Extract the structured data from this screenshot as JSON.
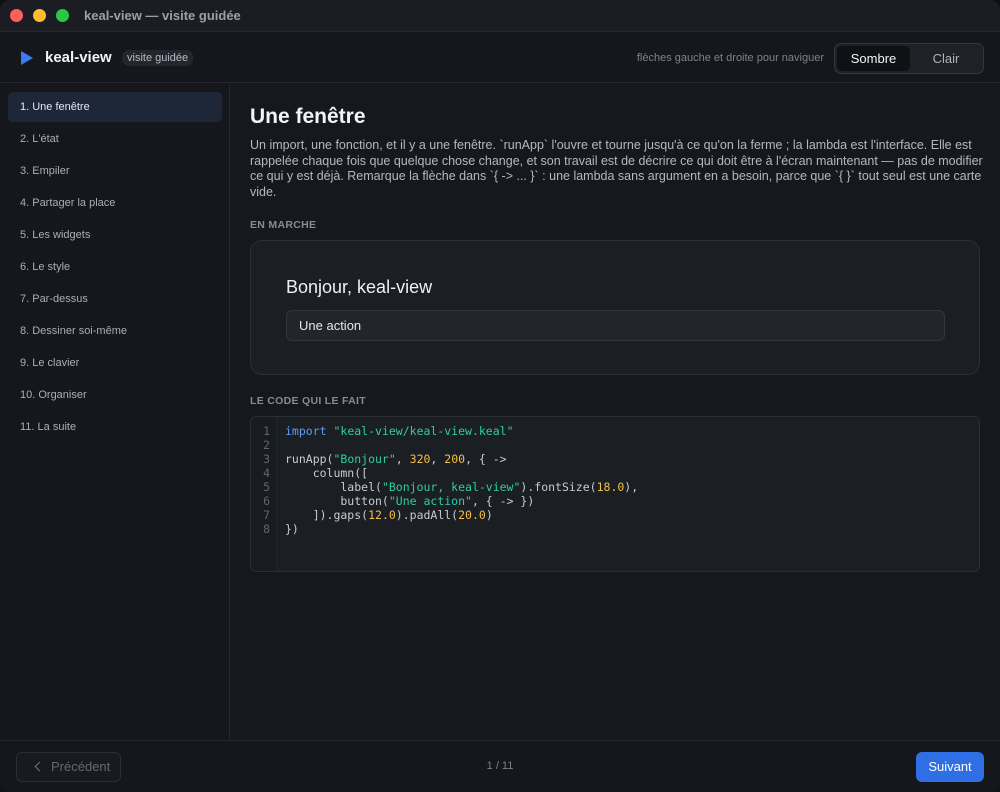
{
  "window": {
    "title": "keal-view — visite guidée"
  },
  "header": {
    "app_name": "keal-view",
    "badge": "visite guidée",
    "hint": "flèches gauche et droite pour naviguer",
    "theme_dark": "Sombre",
    "theme_light": "Clair",
    "theme_selected": "Sombre"
  },
  "sidebar": {
    "active_index": 0,
    "items": [
      {
        "label": "1. Une fenêtre"
      },
      {
        "label": "2. L'état"
      },
      {
        "label": "3. Empiler"
      },
      {
        "label": "4. Partager la place"
      },
      {
        "label": "5. Les widgets"
      },
      {
        "label": "6. Le style"
      },
      {
        "label": "7. Par-dessus"
      },
      {
        "label": "8. Dessiner soi-même"
      },
      {
        "label": "9. Le clavier"
      },
      {
        "label": "10. Organiser"
      },
      {
        "label": "11. La suite"
      }
    ]
  },
  "main": {
    "title": "Une fenêtre",
    "intro": "Un import, une fonction, et il y a une fenêtre. `runApp` l'ouvre et tourne jusqu'à ce qu'on la ferme ; la lambda est l'interface. Elle est rappelée chaque fois que quelque chose change, et son travail est de décrire ce qui doit être à l'écran maintenant — pas de modifier ce qui y est déjà. Remarque la flèche dans `{ -> ... }` : une lambda sans argument en a besoin, parce que `{ }` tout seul est une carte vide.",
    "running_label": "EN MARCHE",
    "demo": {
      "label": "Bonjour, keal-view",
      "button": "Une action"
    },
    "code_label": "LE CODE QUI LE FAIT",
    "code_lines": [
      "import \"keal-view/keal-view.keal\"",
      "",
      "runApp(\"Bonjour\", 320, 200, { ->",
      "    column([",
      "        label(\"Bonjour, keal-view\").fontSize(18.0),",
      "        button(\"Une action\", { -> })",
      "    ]).gaps(12.0).padAll(20.0)",
      "})"
    ]
  },
  "footer": {
    "prev": "Précédent",
    "page": "1 / 11",
    "next": "Suivant"
  },
  "colors": {
    "accent": "#2f6fe6",
    "keyword": "#5b9cf2",
    "string": "#2fcda3",
    "number": "#f2bf4a"
  }
}
